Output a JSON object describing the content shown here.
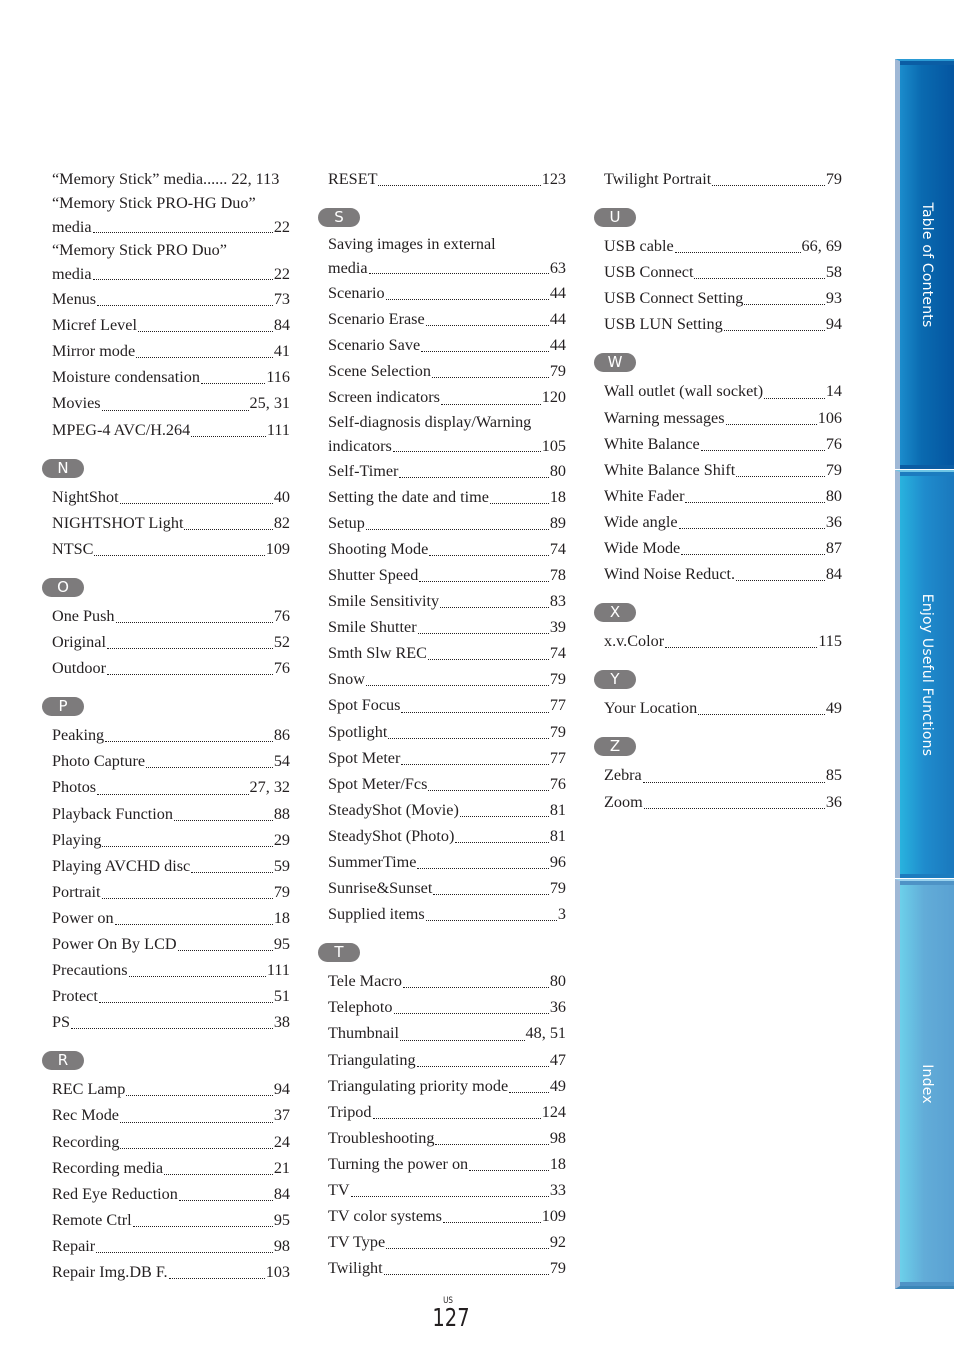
{
  "page": {
    "region_label": "US",
    "number": "127"
  },
  "tabs": [
    {
      "label": "Table of Contents"
    },
    {
      "label": "Enjoy Useful Functions"
    },
    {
      "label": "Index"
    }
  ],
  "colors": {
    "badge": "#7d7b7c",
    "tab_toc": "#0b5da4",
    "tab_enjoy": "#1c7cbf",
    "tab_index": "#5aa1d2"
  },
  "columns": [
    {
      "sections": [
        {
          "letter": null,
          "entries": [
            {
              "term": "“Memory Stick” media......",
              "pages": "22, 113",
              "no_leader": true
            },
            {
              "term_line1": "“Memory Stick PRO-HG Duo”",
              "term": "media",
              "pages": "22"
            },
            {
              "term_line1": "“Memory Stick PRO Duo”",
              "term": "media",
              "pages": "22"
            },
            {
              "term": "Menus",
              "pages": "73"
            },
            {
              "term": "Micref Level",
              "pages": "84"
            },
            {
              "term": "Mirror mode",
              "pages": "41"
            },
            {
              "term": "Moisture condensation",
              "pages": "116"
            },
            {
              "term": "Movies",
              "pages": "25, 31"
            },
            {
              "term": "MPEG-4 AVC/H.264",
              "pages": "111"
            }
          ]
        },
        {
          "letter": "N",
          "entries": [
            {
              "term": "NightShot",
              "pages": "40"
            },
            {
              "term": "NIGHTSHOT Light",
              "pages": "82"
            },
            {
              "term": "NTSC",
              "pages": "109"
            }
          ]
        },
        {
          "letter": "O",
          "entries": [
            {
              "term": "One Push",
              "pages": "76"
            },
            {
              "term": "Original",
              "pages": "52"
            },
            {
              "term": "Outdoor",
              "pages": "76"
            }
          ]
        },
        {
          "letter": "P",
          "entries": [
            {
              "term": "Peaking",
              "pages": "86"
            },
            {
              "term": "Photo Capture",
              "pages": "54"
            },
            {
              "term": "Photos",
              "pages": "27, 32"
            },
            {
              "term": "Playback Function",
              "pages": "88"
            },
            {
              "term": "Playing",
              "pages": "29"
            },
            {
              "term": "Playing AVCHD disc",
              "pages": "59"
            },
            {
              "term": "Portrait",
              "pages": "79"
            },
            {
              "term": "Power on",
              "pages": "18"
            },
            {
              "term": "Power On By LCD",
              "pages": "95"
            },
            {
              "term": "Precautions",
              "pages": "111"
            },
            {
              "term": "Protect",
              "pages": "51"
            },
            {
              "term": "PS",
              "pages": "38"
            }
          ]
        },
        {
          "letter": "R",
          "entries": [
            {
              "term": "REC Lamp",
              "pages": "94"
            },
            {
              "term": "Rec Mode",
              "pages": "37"
            },
            {
              "term": "Recording",
              "pages": "24"
            },
            {
              "term": "Recording media",
              "pages": "21"
            },
            {
              "term": "Red Eye Reduction",
              "pages": "84"
            },
            {
              "term": "Remote Ctrl",
              "pages": "95"
            },
            {
              "term": "Repair",
              "pages": "98"
            },
            {
              "term": "Repair Img.DB F.",
              "pages": "103"
            }
          ]
        }
      ]
    },
    {
      "sections": [
        {
          "letter": null,
          "entries": [
            {
              "term": "RESET",
              "pages": "123"
            }
          ]
        },
        {
          "letter": "S",
          "entries": [
            {
              "term_line1": "Saving images in external",
              "term": "media",
              "pages": "63"
            },
            {
              "term": "Scenario",
              "pages": "44"
            },
            {
              "term": "Scenario Erase",
              "pages": "44"
            },
            {
              "term": "Scenario Save",
              "pages": "44"
            },
            {
              "term": "Scene Selection",
              "pages": "79"
            },
            {
              "term": "Screen indicators",
              "pages": "120"
            },
            {
              "term_line1": "Self-diagnosis display/Warning",
              "term": "indicators",
              "pages": "105"
            },
            {
              "term": "Self-Timer",
              "pages": "80"
            },
            {
              "term": "Setting the date and time",
              "pages": "18"
            },
            {
              "term": "Setup",
              "pages": "89"
            },
            {
              "term": "Shooting Mode",
              "pages": "74"
            },
            {
              "term": "Shutter Speed",
              "pages": "78"
            },
            {
              "term": "Smile Sensitivity",
              "pages": "83"
            },
            {
              "term": "Smile Shutter",
              "pages": "39"
            },
            {
              "term": "Smth Slw REC",
              "pages": "74"
            },
            {
              "term": "Snow",
              "pages": "79"
            },
            {
              "term": "Spot Focus",
              "pages": "77"
            },
            {
              "term": "Spotlight",
              "pages": "79"
            },
            {
              "term": "Spot Meter",
              "pages": "77"
            },
            {
              "term": "Spot Meter/Fcs",
              "pages": "76"
            },
            {
              "term": "SteadyShot (Movie)",
              "pages": "81"
            },
            {
              "term": "SteadyShot (Photo)",
              "pages": "81"
            },
            {
              "term": "SummerTime",
              "pages": "96"
            },
            {
              "term": "Sunrise&Sunset",
              "pages": "79"
            },
            {
              "term": "Supplied items",
              "pages": "3"
            }
          ]
        },
        {
          "letter": "T",
          "entries": [
            {
              "term": "Tele Macro",
              "pages": "80"
            },
            {
              "term": "Telephoto",
              "pages": "36"
            },
            {
              "term": "Thumbnail",
              "pages": "48, 51"
            },
            {
              "term": "Triangulating",
              "pages": "47"
            },
            {
              "term": "Triangulating priority mode",
              "pages": "49"
            },
            {
              "term": "Tripod",
              "pages": "124"
            },
            {
              "term": "Troubleshooting",
              "pages": "98"
            },
            {
              "term": "Turning the power on",
              "pages": "18"
            },
            {
              "term": "TV",
              "pages": "33"
            },
            {
              "term": "TV color systems",
              "pages": "109"
            },
            {
              "term": "TV Type",
              "pages": "92"
            },
            {
              "term": "Twilight",
              "pages": "79"
            }
          ]
        }
      ]
    },
    {
      "sections": [
        {
          "letter": null,
          "entries": [
            {
              "term": "Twilight Portrait",
              "pages": "79"
            }
          ]
        },
        {
          "letter": "U",
          "entries": [
            {
              "term": "USB cable",
              "pages": "66, 69"
            },
            {
              "term": "USB Connect",
              "pages": "58"
            },
            {
              "term": "USB Connect Setting",
              "pages": "93"
            },
            {
              "term": "USB LUN Setting",
              "pages": "94"
            }
          ]
        },
        {
          "letter": "W",
          "entries": [
            {
              "term": "Wall outlet (wall socket)",
              "pages": "14"
            },
            {
              "term": "Warning messages",
              "pages": "106"
            },
            {
              "term": "White Balance",
              "pages": "76"
            },
            {
              "term": "White Balance Shift",
              "pages": "79"
            },
            {
              "term": "White Fader",
              "pages": "80"
            },
            {
              "term": "Wide angle",
              "pages": "36"
            },
            {
              "term": "Wide Mode",
              "pages": "87"
            },
            {
              "term": "Wind Noise Reduct.",
              "pages": "84"
            }
          ]
        },
        {
          "letter": "X",
          "entries": [
            {
              "term": "x.v.Color",
              "pages": "115"
            }
          ]
        },
        {
          "letter": "Y",
          "entries": [
            {
              "term": "Your Location",
              "pages": "49"
            }
          ]
        },
        {
          "letter": "Z",
          "entries": [
            {
              "term": "Zebra",
              "pages": "85"
            },
            {
              "term": "Zoom",
              "pages": "36"
            }
          ]
        }
      ]
    }
  ]
}
